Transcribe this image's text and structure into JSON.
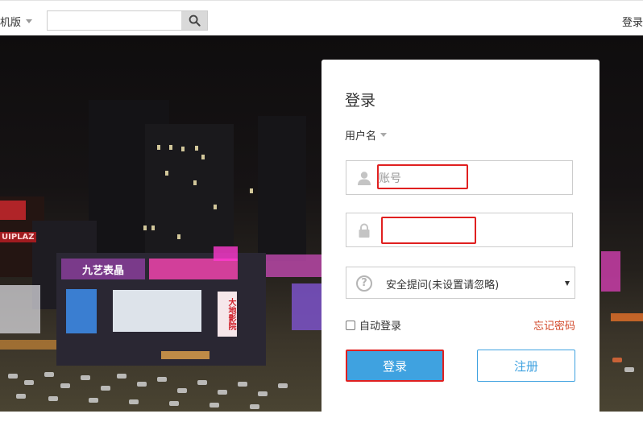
{
  "topbar": {
    "mobile_label": "机版",
    "search_value": "",
    "login_link": "登录"
  },
  "scene": {
    "signs": [
      {
        "text": "UIPLAZ",
        "color": "#ff6a6a"
      },
      {
        "text": "九艺表晶",
        "color": "#e05fc8"
      },
      {
        "text": "大地影院",
        "color": "#e83a3a"
      }
    ]
  },
  "login": {
    "title": "登录",
    "login_type": "用户名",
    "username_placeholder": "账号",
    "password_value": "",
    "security_question": "安全提问(未设置请忽略)",
    "remember_label": "自动登录",
    "forgot_label": "忘记密码",
    "submit_label": "登录",
    "register_label": "注册"
  },
  "colors": {
    "accent": "#3fa2e0",
    "highlight": "#e02020",
    "forgot": "#d24a2b"
  }
}
